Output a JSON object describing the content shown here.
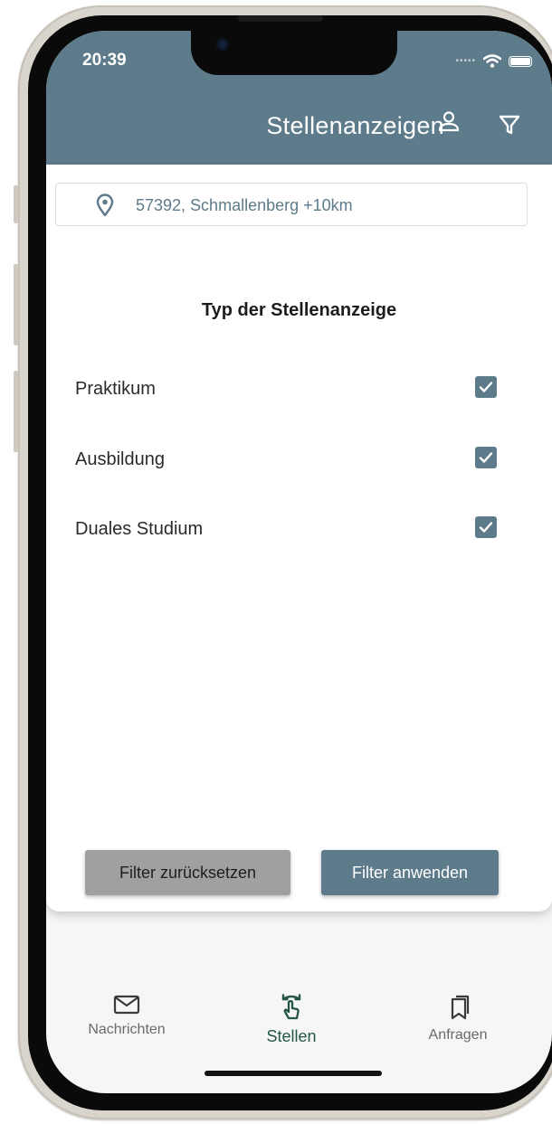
{
  "status_bar": {
    "time": "20:39"
  },
  "header": {
    "title": "Stellenanzeigen"
  },
  "location": {
    "text": "57392, Schmallenberg +10km"
  },
  "filter": {
    "section_title": "Typ der Stellenanzeige",
    "options": [
      {
        "label": "Praktikum",
        "checked": true
      },
      {
        "label": "Ausbildung",
        "checked": true
      },
      {
        "label": "Duales Studium",
        "checked": true
      }
    ],
    "reset_label": "Filter zurücksetzen",
    "apply_label": "Filter anwenden"
  },
  "tabbar": {
    "items": [
      {
        "label": "Nachrichten",
        "icon": "mail-icon"
      },
      {
        "label": "Stellen",
        "icon": "hand-swipe-icon",
        "active": true
      },
      {
        "label": "Anfragen",
        "icon": "bookmark-icon"
      }
    ]
  },
  "colors": {
    "header": "#5d7b8a",
    "accent": "#5d7b8a",
    "active_tab": "#245545",
    "reset_button": "#a0a0a0"
  }
}
